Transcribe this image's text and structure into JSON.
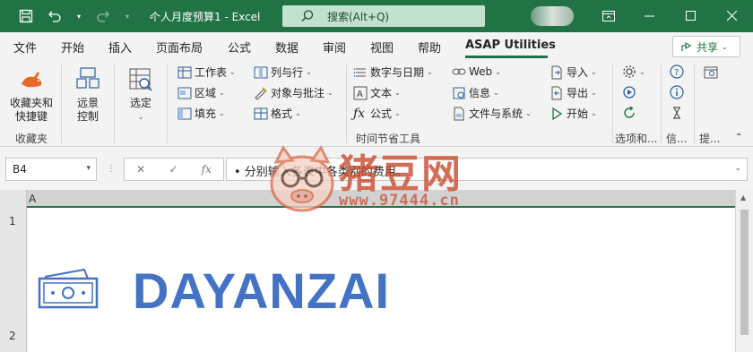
{
  "titlebar": {
    "doc_title": "个人月度预算1  -  Excel",
    "search_label": "搜索(Alt+Q)",
    "colors": {
      "bg": "#217346"
    }
  },
  "tabs": [
    "文件",
    "开始",
    "插入",
    "页面布局",
    "公式",
    "数据",
    "审阅",
    "视图",
    "帮助",
    "ASAP Utilities"
  ],
  "active_tab": "ASAP Utilities",
  "share_label": "共享",
  "ribbon": {
    "favorites": {
      "label": "收藏夹和\n快捷键",
      "group": "收藏夹"
    },
    "remote": {
      "label": "远景\n控制"
    },
    "select": {
      "label": "选定"
    },
    "col1": [
      "工作表",
      "区域",
      "填充"
    ],
    "col2": [
      "列与行",
      "对象与批注",
      "格式"
    ],
    "col3": [
      "数字与日期",
      "文本",
      "公式"
    ],
    "col4": [
      "Web",
      "信息",
      "文件与系统"
    ],
    "col5": [
      "导入",
      "导出",
      "开始"
    ],
    "group_timesaver": "时间节省工具",
    "group_options": "选项和...",
    "group_info": "信...",
    "group_tips": "提..."
  },
  "formula_bar": {
    "name_box": "B4",
    "content": "• 分别输入各表中各类别的费用。"
  },
  "grid": {
    "col_header": "A",
    "rows": [
      "1",
      "2"
    ],
    "banner_text": "DAYANZAI"
  },
  "watermark": {
    "text": "猪豆网",
    "url": "www.97444.cn"
  }
}
